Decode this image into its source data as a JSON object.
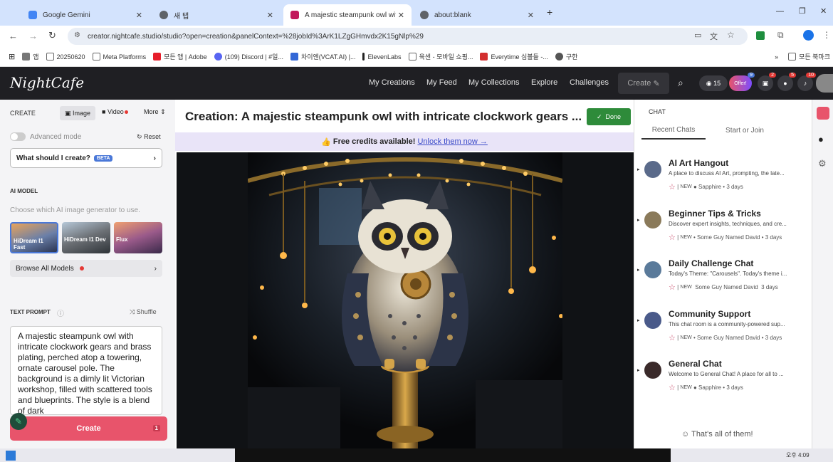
{
  "browser": {
    "tabs": [
      {
        "title": "Google Gemini",
        "favicon_color": "#4285f4"
      },
      {
        "title": "새 탭",
        "favicon_color": "#5f6368"
      },
      {
        "title": "A majestic steampunk owl wit",
        "favicon_color": "#c2185b"
      },
      {
        "title": "about:blank",
        "favicon_color": "#5f6368"
      }
    ],
    "new_tab": "+",
    "url": "creator.nightcafe.studio/studio?open=creation&panelContext=%28jobId%3ArK1LZgGHmvdx2K15gNlp%29",
    "bookmarks": [
      "앱",
      "20250620",
      "Meta Platforms",
      "모든 앱 | Adobe",
      "(109) Discord | #일...",
      "차이엔(VCAT.AI) |...",
      "ElevenLabs",
      "육센 - 모바일 쇼핑...",
      "Everytime 심볼들 -...",
      "구한",
      "모든 북마크"
    ]
  },
  "nightcafe": {
    "logo": "NightCafe",
    "nav": [
      "My Creations",
      "My Feed",
      "My Collections",
      "Explore",
      "Challenges"
    ],
    "create_label": "Create",
    "credits": "15",
    "offer": "Offer!",
    "offer_badge": "9",
    "icon_badges": [
      "2",
      "5",
      "10"
    ]
  },
  "left_panel": {
    "create_label": "CREATE",
    "tabs": [
      "Image",
      "Video",
      "More"
    ],
    "advanced_mode": "Advanced mode",
    "reset": "Reset",
    "what_create": "What should I create?",
    "beta": "BETA",
    "ai_model_label": "AI MODEL",
    "ai_model_hint": "Choose which AI image generator to use.",
    "models": [
      "HiDream I1 Fast",
      "HiDream I1 Dev",
      "Flux"
    ],
    "browse_all": "Browse All Models",
    "text_prompt_label": "TEXT PROMPT",
    "shuffle": "Shuffle",
    "prompt": "A majestic steampunk owl with intricate clockwork gears and brass plating, perched atop a towering, ornate carousel pole. The background is a dimly lit Victorian workshop, filled with scattered tools and blueprints. The style is a blend of dark",
    "create_button": "Create",
    "create_cost": "1"
  },
  "center": {
    "title": "Creation: A majestic steampunk owl with intricate clockwork gears ...",
    "done": "Done",
    "banner_emoji": "👍",
    "banner_bold": "Free credits available!",
    "banner_link": "Unlock them now →"
  },
  "chat": {
    "label": "CHAT",
    "tabs": [
      "Recent Chats",
      "Start or Join"
    ],
    "rooms": [
      {
        "name": "AI Art Hangout",
        "desc": "A place to discuss AI Art, prompting, the late...",
        "tag": "NEW",
        "user": "Sapphire",
        "time": "3 days",
        "color": "#5a6a8a"
      },
      {
        "name": "Beginner Tips & Tricks",
        "desc": "Discover expert insights, techniques, and cre...",
        "tag": "NEW",
        "user": "Some Guy Named David",
        "time": "3 days",
        "color": "#8a7a5a"
      },
      {
        "name": "Daily Challenge Chat",
        "desc": "Today's Theme: \"Carousels\". Today's theme i...",
        "tag": "NEW",
        "user": "Some Guy Named David",
        "time": "3 days",
        "color": "#5a7a9a"
      },
      {
        "name": "Community Support",
        "desc": "This chat room is a community-powered sup...",
        "tag": "NEW",
        "user": "Some Guy Named David",
        "time": "3 days",
        "color": "#4a5a8a"
      },
      {
        "name": "General Chat",
        "desc": "Welcome to General Chat! A place for all to ...",
        "tag": "NEW",
        "user": "Sapphire",
        "time": "3 days",
        "color": "#3a2a2a"
      }
    ],
    "footer": "That's all of them!"
  },
  "taskbar": {
    "time": "오후 4:09"
  }
}
